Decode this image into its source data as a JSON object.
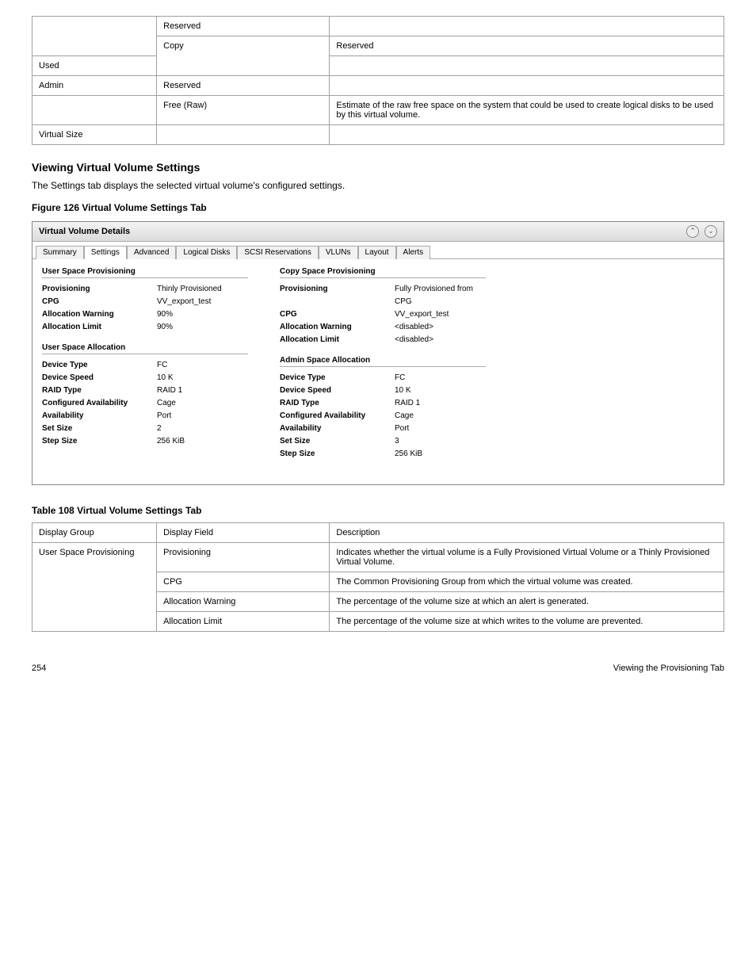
{
  "tableA": {
    "rows": [
      {
        "group": "",
        "field": "Reserved",
        "desc": ""
      },
      {
        "group": "Copy",
        "field": "Reserved",
        "desc": ""
      },
      {
        "group": "",
        "field": "Used",
        "desc": ""
      },
      {
        "group": "Admin",
        "field": "Reserved",
        "desc": ""
      },
      {
        "group": "",
        "field": "Free (Raw)",
        "desc": "Estimate of the raw free space on the system that could be used to create logical disks to be used by this virtual volume."
      },
      {
        "group": "Virtual Size",
        "field": "",
        "desc": ""
      }
    ]
  },
  "section_heading": "Viewing Virtual Volume Settings",
  "section_body": "The Settings tab displays the selected virtual volume's configured settings.",
  "figure_caption": "Figure 126 Virtual Volume Settings Tab",
  "panel": {
    "title": "Virtual Volume Details",
    "tabs": [
      "Summary",
      "Settings",
      "Advanced",
      "Logical Disks",
      "SCSI Reservations",
      "VLUNs",
      "Layout",
      "Alerts"
    ],
    "active_tab_index": 1,
    "left": {
      "prov_title": "User Space Provisioning",
      "prov": [
        {
          "label": "Provisioning",
          "value": "Thinly Provisioned"
        },
        {
          "label": "CPG",
          "value": "VV_export_test"
        },
        {
          "label": "Allocation Warning",
          "value": "90%"
        },
        {
          "label": "Allocation Limit",
          "value": "90%"
        }
      ],
      "alloc_title": "User Space Allocation",
      "alloc": [
        {
          "label": "Device Type",
          "value": "FC"
        },
        {
          "label": "Device Speed",
          "value": "10 K"
        },
        {
          "label": "RAID Type",
          "value": "RAID 1"
        },
        {
          "label": "Configured Availability",
          "value": "Cage"
        },
        {
          "label": "Availability",
          "value": "Port"
        },
        {
          "label": "Set Size",
          "value": "2"
        },
        {
          "label": "Step Size",
          "value": "256 KiB"
        }
      ]
    },
    "right": {
      "prov_title": "Copy Space Provisioning",
      "prov": [
        {
          "label": "Provisioning",
          "value": "Fully Provisioned from CPG"
        },
        {
          "label": "CPG",
          "value": "VV_export_test"
        },
        {
          "label": "Allocation Warning",
          "value": "<disabled>"
        },
        {
          "label": "Allocation Limit",
          "value": "<disabled>"
        }
      ],
      "alloc_title": "Admin Space Allocation",
      "alloc": [
        {
          "label": "Device Type",
          "value": "FC"
        },
        {
          "label": "Device Speed",
          "value": "10 K"
        },
        {
          "label": "RAID Type",
          "value": "RAID 1"
        },
        {
          "label": "Configured Availability",
          "value": "Cage"
        },
        {
          "label": "Availability",
          "value": "Port"
        },
        {
          "label": "Set Size",
          "value": "3"
        },
        {
          "label": "Step Size",
          "value": "256 KiB"
        }
      ]
    }
  },
  "tableB": {
    "caption": "Table 108 Virtual Volume Settings Tab",
    "headers": [
      "Display Group",
      "Display Field",
      "Description"
    ],
    "rows": [
      {
        "group": "User Space Provisioning",
        "field": "Provisioning",
        "desc": "Indicates whether the virtual volume is a Fully Provisioned Virtual Volume or a Thinly Provisioned Virtual Volume."
      },
      {
        "group": "",
        "field": "CPG",
        "desc": "The Common Provisioning Group from which the virtual volume was created."
      },
      {
        "group": "",
        "field": "Allocation Warning",
        "desc": "The percentage of the volume size at which an alert is generated."
      },
      {
        "group": "",
        "field": "Allocation Limit",
        "desc": "The percentage of the volume size at which writes to the volume are prevented."
      }
    ]
  },
  "footer": {
    "left": "254",
    "right": "Viewing the Provisioning Tab"
  }
}
